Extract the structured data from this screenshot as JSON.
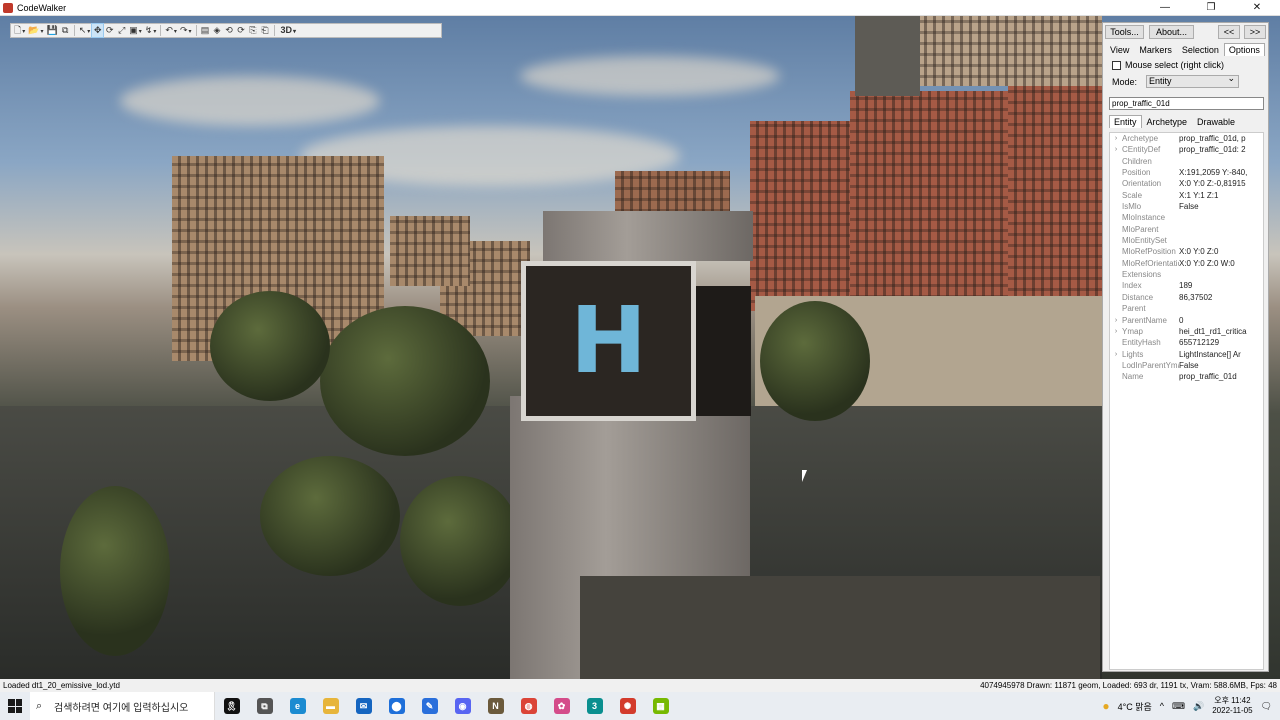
{
  "window": {
    "title": "CodeWalker",
    "controls": [
      "—",
      "❐",
      "✕"
    ]
  },
  "toolbar": {
    "buttons": [
      {
        "name": "new",
        "glyph": "🗋",
        "dropdown": true
      },
      {
        "name": "open",
        "glyph": "📂",
        "dropdown": true
      },
      {
        "name": "save",
        "glyph": "💾"
      },
      {
        "name": "save-all",
        "glyph": "⧉"
      },
      {
        "name": "select",
        "glyph": "↖",
        "dropdown": true
      },
      {
        "name": "move",
        "glyph": "✥",
        "selected": true
      },
      {
        "name": "rotate",
        "glyph": "⟳"
      },
      {
        "name": "scale",
        "glyph": "⤢"
      },
      {
        "name": "snap",
        "glyph": "▣",
        "dropdown": true
      },
      {
        "name": "camera",
        "glyph": "↯",
        "dropdown": true
      },
      {
        "name": "undo",
        "glyph": "↶",
        "dropdown": true
      },
      {
        "name": "redo",
        "glyph": "↷",
        "dropdown": true
      },
      {
        "name": "info",
        "glyph": "▤"
      },
      {
        "name": "fullscreen",
        "glyph": "◈"
      },
      {
        "name": "grid",
        "glyph": "⟲"
      },
      {
        "name": "collision",
        "glyph": "⟳"
      },
      {
        "name": "copy",
        "glyph": "⎘"
      },
      {
        "name": "paste",
        "glyph": "⎗"
      }
    ],
    "mode_label": "3D"
  },
  "panel": {
    "tools_label": "Tools...",
    "about_label": "About...",
    "collapse_label": "<<",
    "expand_label": ">>",
    "tabs": [
      "View",
      "Markers",
      "Selection",
      "Options"
    ],
    "active_tab": "Selection",
    "mouse_select_label": "Mouse select (right click)",
    "mouse_select_checked": false,
    "mode_label": "Mode:",
    "mode_value": "Entity",
    "selected_name": "prop_traffic_01d",
    "sub_tabs": [
      "Entity",
      "Archetype",
      "Drawable"
    ],
    "active_sub_tab": "Entity",
    "properties": [
      {
        "name": "Archetype",
        "value": "prop_traffic_01d, p",
        "expandable": true
      },
      {
        "name": "CEntityDef",
        "value": "prop_traffic_01d: 2",
        "expandable": true
      },
      {
        "name": "Children",
        "value": "",
        "expandable": false
      },
      {
        "name": "Position",
        "value": "X:191,2059 Y:-840,",
        "expandable": false
      },
      {
        "name": "Orientation",
        "value": "X:0 Y:0 Z:-0,81915",
        "expandable": false
      },
      {
        "name": "Scale",
        "value": "X:1 Y:1 Z:1",
        "expandable": false
      },
      {
        "name": "IsMlo",
        "value": "False",
        "expandable": false
      },
      {
        "name": "MloInstance",
        "value": "",
        "expandable": false
      },
      {
        "name": "MloParent",
        "value": "",
        "expandable": false
      },
      {
        "name": "MloEntitySet",
        "value": "",
        "expandable": false
      },
      {
        "name": "MloRefPosition",
        "value": "X:0 Y:0 Z:0",
        "expandable": false
      },
      {
        "name": "MloRefOrientation",
        "value": "X:0 Y:0 Z:0 W:0",
        "expandable": false
      },
      {
        "name": "Extensions",
        "value": "",
        "expandable": false
      },
      {
        "name": "Index",
        "value": "189",
        "expandable": false
      },
      {
        "name": "Distance",
        "value": "86,37502",
        "expandable": false
      },
      {
        "name": "Parent",
        "value": "",
        "expandable": false
      },
      {
        "name": "ParentName",
        "value": "0",
        "expandable": true
      },
      {
        "name": "Ymap",
        "value": "hei_dt1_rd1_critica",
        "expandable": true
      },
      {
        "name": "EntityHash",
        "value": "655712129",
        "expandable": false
      },
      {
        "name": "Lights",
        "value": "LightInstance[] Ar",
        "expandable": true
      },
      {
        "name": "LodInParentYmap",
        "value": "False",
        "expandable": false
      },
      {
        "name": "Name",
        "value": "prop_traffic_01d",
        "expandable": false
      }
    ]
  },
  "status": {
    "left": "Loaded dt1_20_emissive_lod.ytd",
    "right": "4074945978  Drawn: 11871 geom, Loaded: 693 dr, 1191 tx, Vram: 588.6MB, Fps: 48"
  },
  "taskbar": {
    "search_placeholder": "검색하려면 여기에 입력하십시오",
    "weather": "4°C 맑음",
    "time_period": "오후 11:42",
    "date": "2022-11-05",
    "apps": [
      {
        "name": "ribbon-app",
        "glyph": "🎗",
        "color": "#111111"
      },
      {
        "name": "task-view",
        "glyph": "⧉",
        "color": "#555555"
      },
      {
        "name": "edge",
        "glyph": "e",
        "color": "#1b8bd1"
      },
      {
        "name": "file-explorer",
        "glyph": "▬",
        "color": "#e7b53b"
      },
      {
        "name": "mail",
        "glyph": "✉",
        "color": "#1565c0"
      },
      {
        "name": "app-blue",
        "glyph": "⬤",
        "color": "#1e6fd9"
      },
      {
        "name": "app-dev",
        "glyph": "✎",
        "color": "#2a6fdb"
      },
      {
        "name": "discord",
        "glyph": "◉",
        "color": "#5865f2"
      },
      {
        "name": "notepad",
        "glyph": "N",
        "color": "#6b5a3c"
      },
      {
        "name": "chrome",
        "glyph": "◍",
        "color": "#db4437"
      },
      {
        "name": "app-paint",
        "glyph": "✿",
        "color": "#d44c8a"
      },
      {
        "name": "app-3",
        "glyph": "3",
        "color": "#0a8f8f"
      },
      {
        "name": "codewalker",
        "glyph": "✺",
        "color": "#d33b2c"
      },
      {
        "name": "nvidia",
        "glyph": "▦",
        "color": "#76b900"
      }
    ],
    "tray_icons": [
      "^",
      "⌨",
      "🔊",
      "🗨"
    ]
  }
}
